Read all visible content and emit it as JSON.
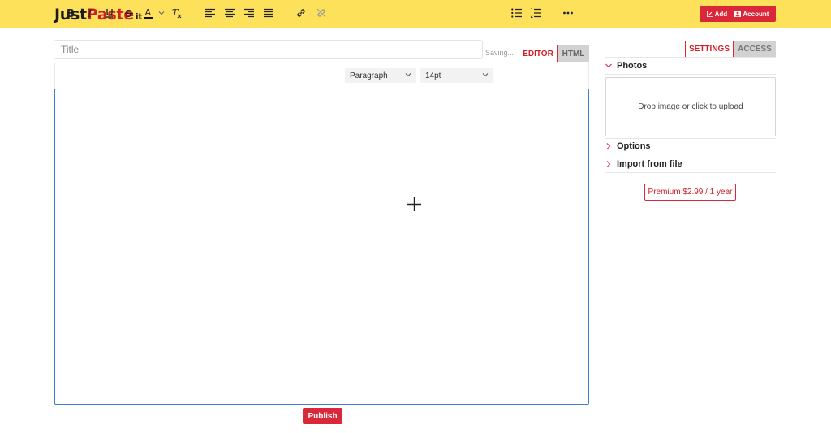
{
  "header": {
    "logo": {
      "part1": "Just",
      "part2": "Paste",
      "part3": "it"
    },
    "add_label": "Add",
    "account_label": "Account"
  },
  "editor": {
    "title_placeholder": "Title",
    "saving_status": "Saving...",
    "tabs": {
      "editor": "EDITOR",
      "html": "HTML"
    },
    "toolbar": {
      "block_format": "Paragraph",
      "font_size": "14pt"
    },
    "publish_label": "Publish"
  },
  "sidebar": {
    "tabs": {
      "settings": "SETTINGS",
      "access": "ACCESS"
    },
    "photos_label": "Photos",
    "dropzone_text": "Drop image or click to upload",
    "options_label": "Options",
    "import_label": "Import from file",
    "premium_label": "Premium $2.99 / 1 year"
  },
  "colors": {
    "header_bg": "#fde15b",
    "accent_red": "#d8283a",
    "editor_border": "#3b7fd6"
  }
}
